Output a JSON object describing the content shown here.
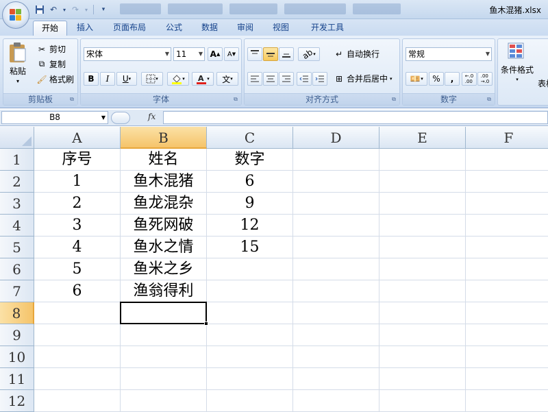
{
  "window": {
    "title": "鱼木混猪.xlsx"
  },
  "tabs": [
    "开始",
    "插入",
    "页面布局",
    "公式",
    "数据",
    "审阅",
    "视图",
    "开发工具"
  ],
  "clipboard": {
    "paste": "粘贴",
    "cut": "剪切",
    "copy": "复制",
    "format_painter": "格式刷",
    "label": "剪贴板"
  },
  "font": {
    "name": "宋体",
    "size": "11",
    "grow": "A",
    "shrink": "A",
    "bold": "B",
    "italic": "I",
    "underline": "U",
    "phonetic": "文",
    "label": "字体"
  },
  "alignment": {
    "wrap": "自动换行",
    "merge": "合并后居中",
    "label": "对齐方式"
  },
  "number": {
    "format": "常规",
    "percent": "%",
    "comma": ",",
    "label": "数字"
  },
  "styles": {
    "conditional": "条件格式",
    "table": "表格"
  },
  "formula_bar": {
    "name_box": "B8",
    "fx": "fx",
    "content": ""
  },
  "columns": [
    "A",
    "B",
    "C",
    "D",
    "E",
    "F"
  ],
  "rows": [
    "1",
    "2",
    "3",
    "4",
    "5",
    "6",
    "7",
    "8",
    "9",
    "10",
    "11",
    "12"
  ],
  "cells": {
    "A": [
      "序号",
      "1",
      "2",
      "3",
      "4",
      "5",
      "6"
    ],
    "B": [
      "姓名",
      "鱼木混猪",
      "鱼龙混杂",
      "鱼死网破",
      "鱼水之情",
      "鱼米之乡",
      "渔翁得利"
    ],
    "C": [
      "数字",
      "6",
      "9",
      "12",
      "15"
    ]
  },
  "selection": {
    "cell": "B8",
    "column": "B",
    "row": "8"
  },
  "colors": {
    "accent": "#f5c46a",
    "ribbon": "#d2e0f2",
    "tab_text": "#15428b"
  }
}
